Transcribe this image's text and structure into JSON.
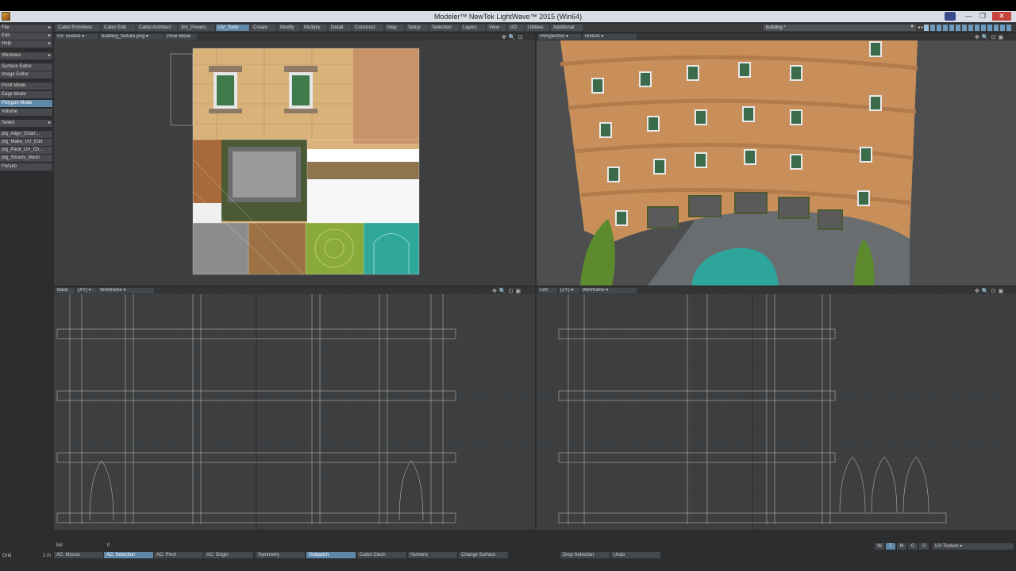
{
  "window": {
    "title": "Modeler™ NewTek LightWave™ 2015 (Win64)",
    "controls": [
      "—",
      "❐",
      "✕"
    ]
  },
  "tabs": [
    {
      "label": "Cattoi Primitives",
      "active": false
    },
    {
      "label": "Cattoi Edit",
      "active": false
    },
    {
      "label": "Cattoi Architect",
      "active": false
    },
    {
      "label": "3rd_Powers",
      "active": false
    },
    {
      "label": "UV_Tools",
      "active": true
    },
    {
      "label": "Create",
      "active": false
    },
    {
      "label": "Modify",
      "active": false
    },
    {
      "label": "Multiply",
      "active": false
    },
    {
      "label": "Detail",
      "active": false
    },
    {
      "label": "Construct",
      "active": false
    },
    {
      "label": "Map",
      "active": false
    },
    {
      "label": "Setup",
      "active": false
    },
    {
      "label": "Selection",
      "active": false
    },
    {
      "label": "Layers",
      "active": false
    },
    {
      "label": "View",
      "active": false
    },
    {
      "label": "I/O",
      "active": false
    },
    {
      "label": "Utilities",
      "active": false
    },
    {
      "label": "Additional",
      "active": false
    }
  ],
  "layer": {
    "name": "building *"
  },
  "sidebar": {
    "menus": [
      "File",
      "Edit",
      "Help",
      "Windows"
    ],
    "editors": [
      "Surface Editor",
      "Image Editor"
    ],
    "modes": [
      {
        "label": "Point Mode",
        "active": false
      },
      {
        "label": "Edge Mode",
        "active": false
      },
      {
        "label": "Polygon Mode",
        "active": true
      },
      {
        "label": "Volume",
        "active": false
      }
    ],
    "select": "Select",
    "plugins": [
      "plg_Align_Chart...",
      "plg_Make_UV_Edit",
      "plg_Pack_UV_Ch...",
      "plg_Smarts_Mesh",
      "FitAuto"
    ]
  },
  "viewports": {
    "uv": {
      "view": "UV Texture",
      "image": "building_texture.png",
      "mode": "Pose Move"
    },
    "persp": {
      "view": "Perspective",
      "mode": "Texture"
    },
    "back": {
      "view": "Back",
      "axes": "(XY)",
      "mode": "Wireframe"
    },
    "left": {
      "view": "Left",
      "axes": "(ZY)",
      "mode": "Wireframe"
    }
  },
  "bottom": {
    "sel_label": "Sel",
    "sel_count": "0",
    "grid_label": "Grid",
    "grid_value": "1 m",
    "buttons": [
      {
        "label": "AC: Mouse",
        "active": false
      },
      {
        "label": "AC: Selection",
        "active": true
      },
      {
        "label": "AC: Pivot",
        "active": false
      },
      {
        "label": "AC: Origin",
        "active": false
      },
      {
        "label": "Symmetry",
        "active": false
      },
      {
        "label": "Subpatch",
        "active": true
      },
      {
        "label": "Cattoi Clash",
        "active": false
      },
      {
        "label": "Numeric",
        "active": false
      },
      {
        "label": "Change Surface",
        "active": false
      },
      {
        "label": "Drop Selection",
        "active": false
      },
      {
        "label": "Undo",
        "active": false
      }
    ],
    "vmap_modes": [
      {
        "label": "W",
        "active": false
      },
      {
        "label": "T",
        "active": true
      },
      {
        "label": "M",
        "active": false
      },
      {
        "label": "C",
        "active": false
      },
      {
        "label": "S",
        "active": false
      }
    ],
    "vmap": "UV Texture"
  },
  "colors": {
    "accent": "#5f87a8",
    "teal": "#2fa89a",
    "green": "#8aaa3a",
    "brick": "#d9b27a"
  }
}
